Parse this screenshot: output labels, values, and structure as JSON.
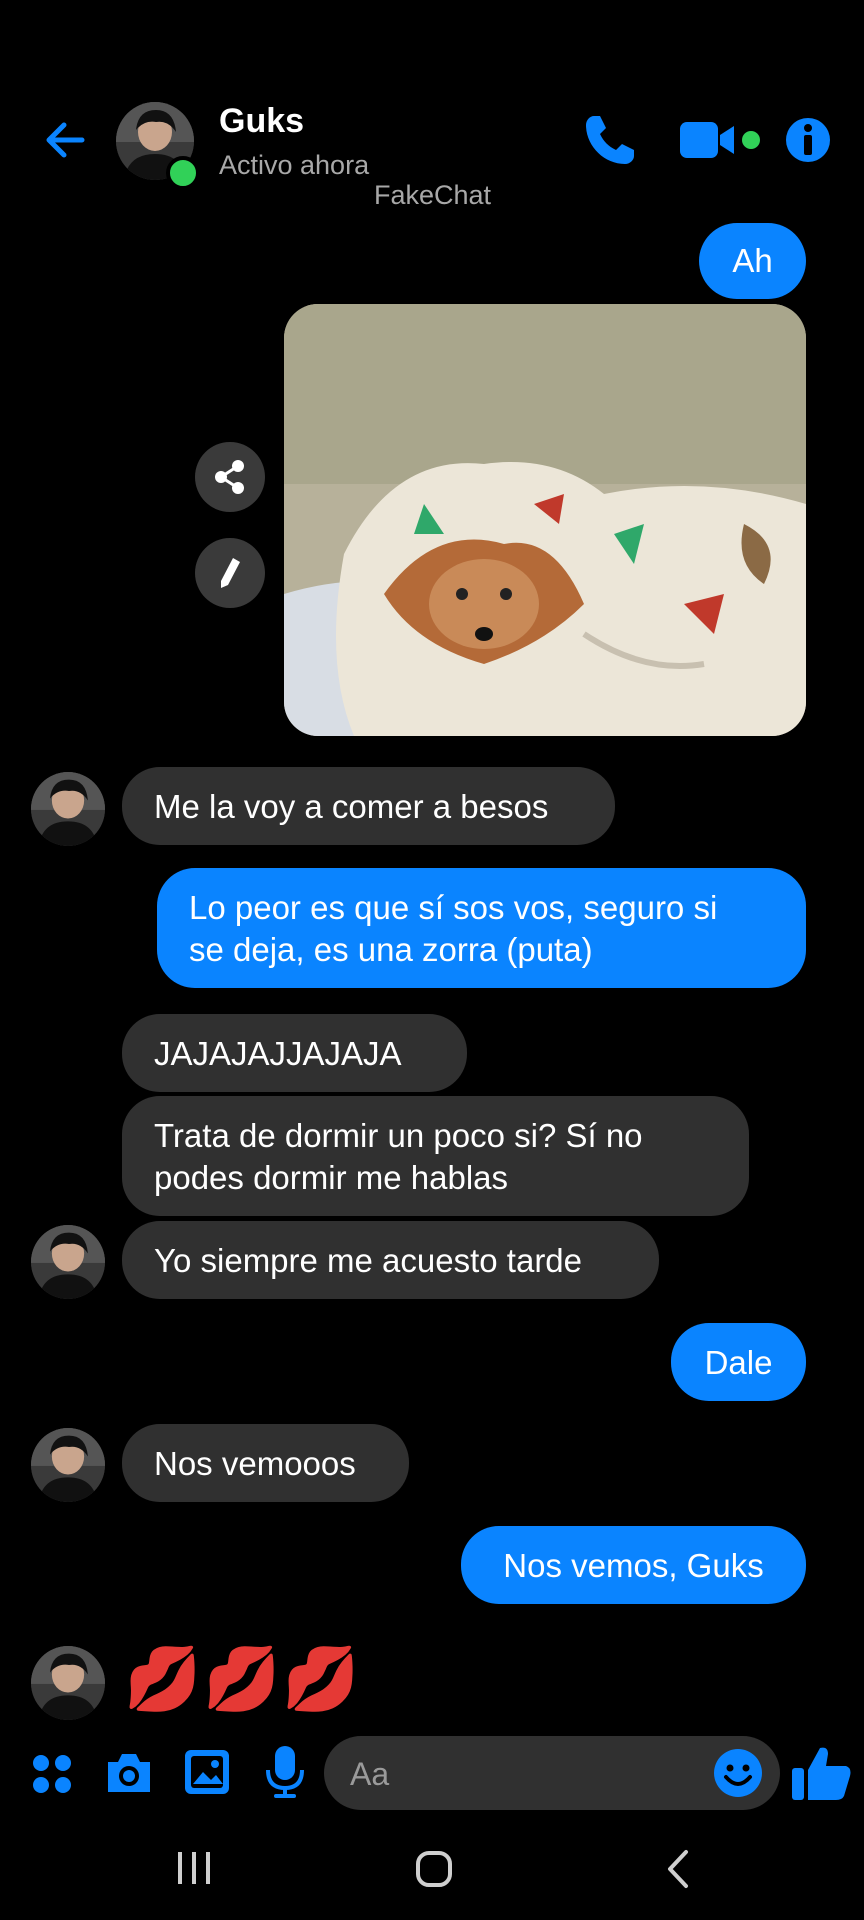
{
  "header": {
    "contact_name": "Guks",
    "status": "Activo ahora",
    "watermark": "FakeChat",
    "icons": [
      "back-arrow-icon",
      "phone-icon",
      "video-camera-icon",
      "info-icon"
    ]
  },
  "messages": [
    {
      "side": "out",
      "text": "Ah"
    },
    {
      "side": "out",
      "type": "image",
      "description_icon": "photo"
    },
    {
      "side": "in",
      "text": "Me la voy a comer a besos"
    },
    {
      "side": "out",
      "text": "Lo peor es que sí sos vos, seguro si\nse deja, es una zorra (puta)"
    },
    {
      "side": "in",
      "text": "JAJAJAJJAJAJA"
    },
    {
      "side": "in",
      "text": "Trata de dormir un poco si? Sí no\npodes dormir me hablas"
    },
    {
      "side": "in",
      "text": "Yo siempre me acuesto tarde"
    },
    {
      "side": "out",
      "text": "Dale"
    },
    {
      "side": "in",
      "text": "Nos vemooos"
    },
    {
      "side": "out",
      "text": "Nos vemos, Guks"
    },
    {
      "side": "in",
      "type": "emoji",
      "text": "💋💋💋"
    }
  ],
  "photo_actions": [
    "share-icon",
    "edit-icon"
  ],
  "composer": {
    "placeholder": "Aa",
    "icons": [
      "apps-icon",
      "camera-icon",
      "gallery-icon",
      "microphone-icon",
      "emoji-icon",
      "thumbs-up-icon"
    ]
  },
  "navbar": [
    "recent-apps-icon",
    "home-icon",
    "back-nav-icon"
  ],
  "colors": {
    "accent": "#0a84ff",
    "incoming_bubble": "#303030",
    "online": "#31d158",
    "background": "#000000"
  }
}
